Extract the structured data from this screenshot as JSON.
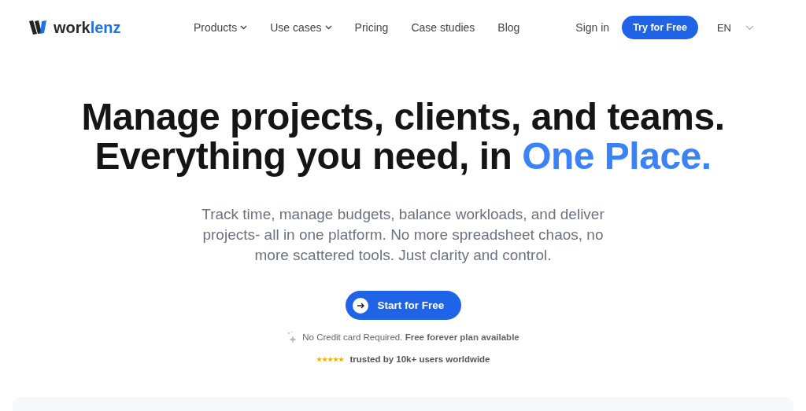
{
  "logo": {
    "text_main": "work",
    "text_accent": "lenz"
  },
  "nav": [
    {
      "label": "Products",
      "has_menu": true
    },
    {
      "label": "Use cases",
      "has_menu": true
    },
    {
      "label": "Pricing",
      "has_menu": false
    },
    {
      "label": "Case studies",
      "has_menu": false
    },
    {
      "label": "Blog",
      "has_menu": false
    }
  ],
  "sign_in": "Sign in",
  "try_button": "Try for Free",
  "language": "EN",
  "headline": {
    "line_1": "Manage projects, clients, and teams.",
    "line_2_start": "Everything you need, in ",
    "line_2_accent": "One Place."
  },
  "subtitle": "Track time, manage budgets, balance workloads, and deliver projects- all in one platform. No more spreadsheet chaos, no more scattered tools. Just clarity and control.",
  "cta": "Start for Free",
  "note": "No Credit card Required. **Free forever plan available**",
  "rating": {
    "stars": 5,
    "text": "trusted by 10k+ users worldwide"
  }
}
